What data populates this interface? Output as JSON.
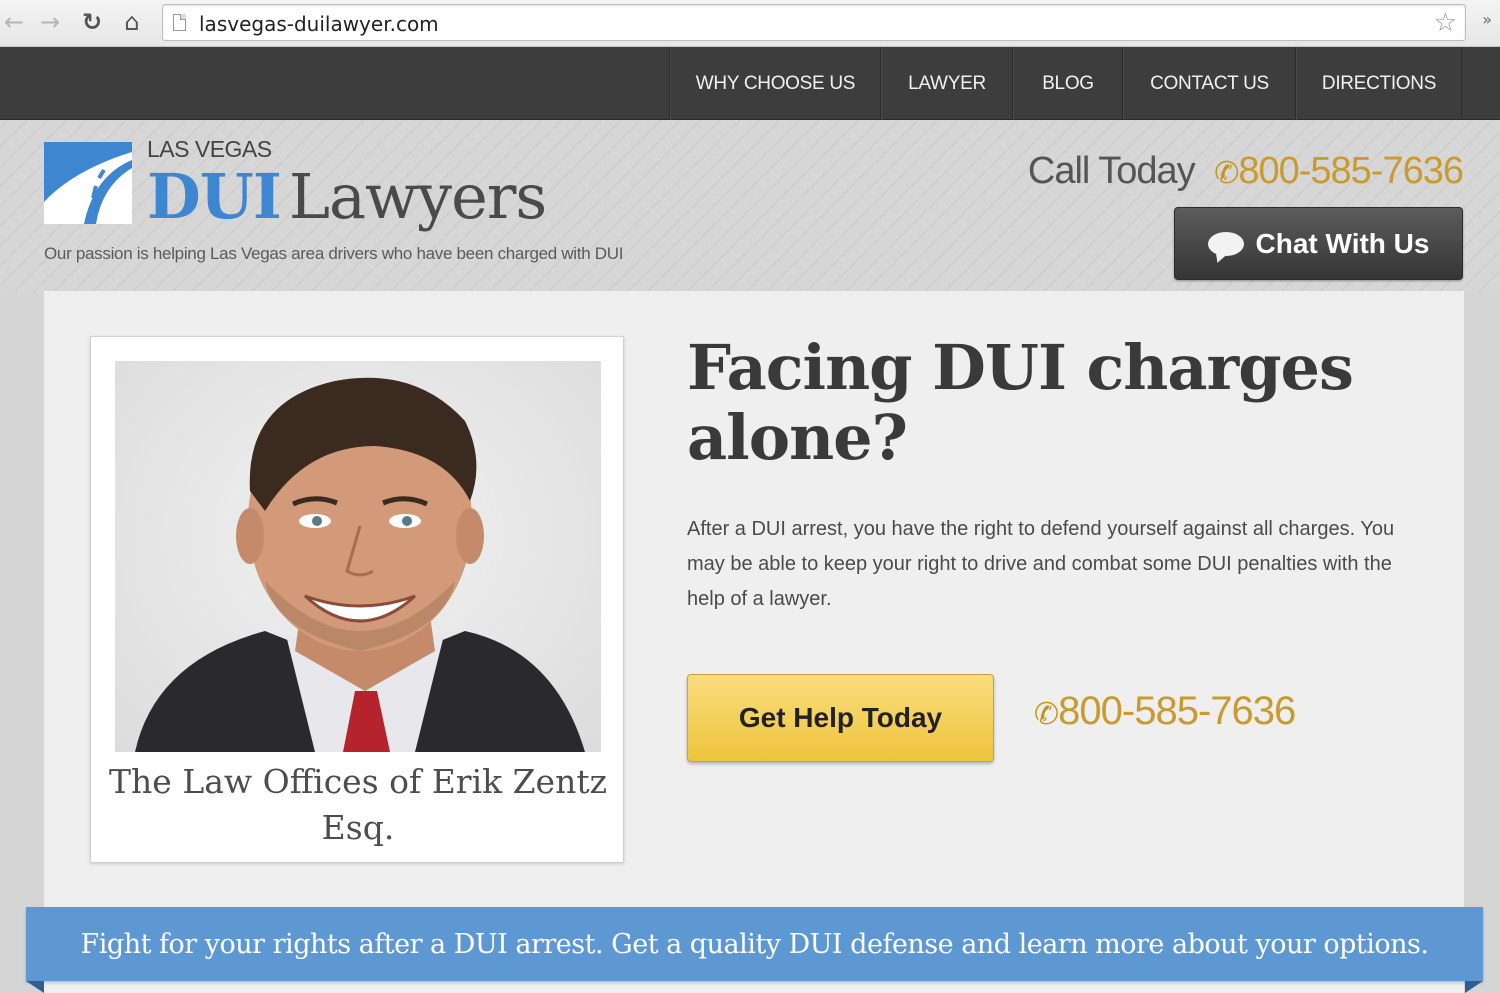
{
  "browser": {
    "url": "lasvegas-duilawyer.com",
    "icons": [
      "back-arrow-icon",
      "forward-arrow-icon",
      "reload-icon",
      "home-icon",
      "page-icon",
      "bookmark-star-icon",
      "extensions-chevron-icon"
    ]
  },
  "nav": {
    "items": [
      "WHY CHOOSE US",
      "LAWYER",
      "BLOG",
      "CONTACT US",
      "DIRECTIONS"
    ]
  },
  "header": {
    "logo_small": "LAS VEGAS",
    "logo_dui": "DUI",
    "logo_lawyers": "Lawyers",
    "tagline": "Our passion is helping Las Vegas area drivers who have been charged with DUI",
    "call_label": "Call Today",
    "phone": "800-585-7636",
    "chat_label": "Chat With Us"
  },
  "hero": {
    "caption": "The Law Offices of Erik Zentz Esq.",
    "headline": "Facing DUI charges alone?",
    "intro": "After a DUI arrest, you have the right to defend yourself against all charges. You may be able to keep your right to drive and combat some DUI penalties with the help of a lawyer.",
    "cta_label": "Get Help Today",
    "phone": "800-585-7636"
  },
  "banner": {
    "text": "Fight for your rights after a DUI arrest. Get a quality DUI defense and learn more about your options."
  },
  "colors": {
    "brand_blue": "#3e86cf",
    "accent_gold": "#c99a2e",
    "nav_bg": "#3d3d3d",
    "banner_blue": "#5e98d2"
  }
}
